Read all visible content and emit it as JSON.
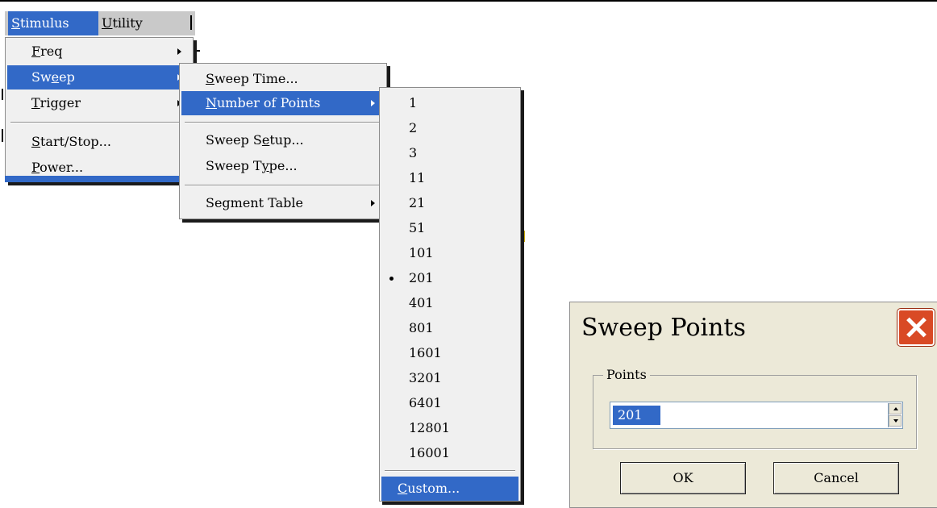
{
  "menubar": {
    "stimulus": {
      "before": "",
      "ul": "S",
      "after": "timulus"
    },
    "utility": {
      "before": "",
      "ul": "U",
      "after": "tility"
    }
  },
  "stimulus_menu": {
    "freq": {
      "before": "",
      "ul": "F",
      "after": "req"
    },
    "sweep": {
      "before": "Sw",
      "ul": "e",
      "after": "ep"
    },
    "trigger": {
      "before": "",
      "ul": "T",
      "after": "rigger"
    },
    "start_stop": {
      "before": "",
      "ul": "S",
      "after": "tart/Stop..."
    },
    "power": {
      "before": "",
      "ul": "P",
      "after": "ower..."
    }
  },
  "sweep_menu": {
    "sweep_time": {
      "before": "",
      "ul": "S",
      "after": "weep Time..."
    },
    "number_of_points": {
      "before": "",
      "ul": "N",
      "after": "umber of Points"
    },
    "sweep_setup": {
      "before": "Sweep S",
      "ul": "e",
      "after": "tup..."
    },
    "sweep_type": {
      "before": "Sweep T",
      "ul": "y",
      "after": "pe..."
    },
    "segment_table": "Segment Table"
  },
  "points_menu": {
    "options": [
      "1",
      "2",
      "3",
      "11",
      "21",
      "51",
      "101",
      "201",
      "401",
      "801",
      "1601",
      "3201",
      "6401",
      "12801",
      "16001"
    ],
    "checked": "201",
    "custom": {
      "before": "",
      "ul": "C",
      "after": "ustom..."
    }
  },
  "dialog": {
    "title": "Sweep Points",
    "group_label": "Points",
    "value": "201",
    "ok_label": "OK",
    "cancel_label": "Cancel"
  },
  "colors": {
    "highlight": "#3269c7",
    "menu_bg": "#f0f0f0",
    "dialog_bg": "#ece9d8",
    "close_button": "#d94a25"
  }
}
